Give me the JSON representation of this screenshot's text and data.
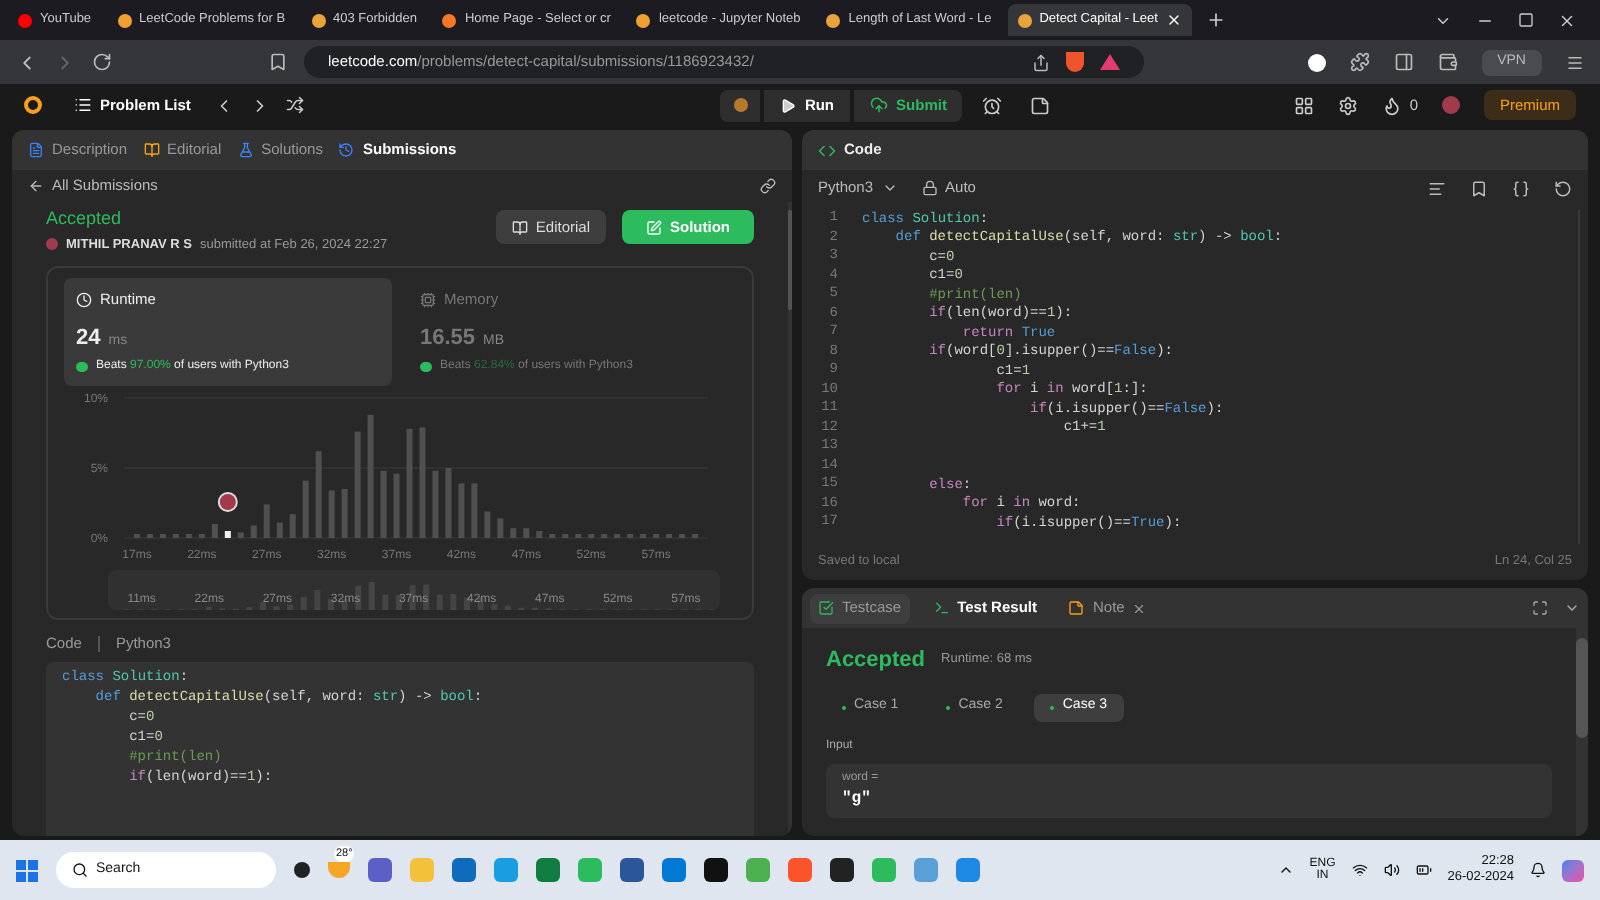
{
  "browser": {
    "tabs": [
      {
        "title": "YouTube",
        "selected": false,
        "color": "#ff0000"
      },
      {
        "title": "LeetCode Problems for B",
        "selected": false,
        "color": "#f0a030"
      },
      {
        "title": "403 Forbidden",
        "selected": false,
        "color": "#e8a33a"
      },
      {
        "title": "Home Page - Select or cr",
        "selected": false,
        "color": "#f37726"
      },
      {
        "title": "leetcode - Jupyter Noteb",
        "selected": false,
        "color": "#f0a030"
      },
      {
        "title": "Length of Last Word - Le",
        "selected": false,
        "color": "#e8a33a"
      },
      {
        "title": "Detect Capital - Leet",
        "selected": true,
        "color": "#e8a33a"
      }
    ],
    "url_host": "leetcode.com",
    "url_path": "/problems/detect-capital/submissions/1186923432/",
    "vpn": "VPN"
  },
  "nav": {
    "problem_list": "Problem List",
    "run": "Run",
    "submit": "Submit",
    "streak": "0",
    "premium": "Premium"
  },
  "left": {
    "tabs": [
      {
        "label": "Description",
        "selected": false
      },
      {
        "label": "Editorial",
        "selected": false
      },
      {
        "label": "Solutions",
        "selected": false
      },
      {
        "label": "Submissions",
        "selected": true
      }
    ],
    "back": "All Submissions",
    "status": "Accepted",
    "author": "MITHIL PRANAV R S",
    "submitted": "submitted at Feb 26, 2024 22:27",
    "buttons": [
      "Editorial",
      "Solution"
    ],
    "stats": [
      {
        "label": "Runtime",
        "value": "24",
        "unit": "ms",
        "prefix": "Beats",
        "percent": "97.00%",
        "suffix": "of users with Python3",
        "selected": true
      },
      {
        "label": "Memory",
        "value": "16.55",
        "unit": "MB",
        "prefix": "Beats",
        "percent": "62.84%",
        "suffix": "of users with Python3",
        "selected": false
      }
    ],
    "chart_data": {
      "type": "bar",
      "x": [
        17,
        18,
        19,
        20,
        21,
        22,
        23,
        24,
        25,
        26,
        27,
        28,
        29,
        30,
        31,
        32,
        33,
        34,
        35,
        36,
        37,
        38,
        39,
        40,
        41,
        42,
        43,
        44,
        45,
        46,
        47,
        48,
        49,
        50,
        51,
        52,
        53,
        54,
        55,
        56,
        57,
        58,
        59,
        60
      ],
      "values": [
        0.2,
        0.2,
        0.2,
        0.2,
        0.2,
        0.2,
        1.0,
        0.5,
        0.4,
        0.9,
        2.4,
        1.1,
        1.7,
        4.1,
        6.2,
        3.4,
        3.5,
        7.6,
        8.8,
        4.8,
        4.6,
        7.8,
        7.9,
        4.8,
        5.0,
        3.9,
        3.9,
        1.9,
        1.4,
        0.7,
        0.7,
        0.5,
        0.2,
        0.2,
        0.2,
        0.2,
        0.2,
        0.2,
        0.2,
        0.2,
        0.2,
        0.2,
        0.2,
        0.2
      ],
      "xlim": [
        16,
        61
      ],
      "ylim": [
        0,
        10
      ],
      "yticks": [
        {
          "value": 0,
          "label": "0%"
        },
        {
          "value": 5,
          "label": "5%"
        },
        {
          "value": 10,
          "label": "10%"
        }
      ],
      "xticks": [
        {
          "value": 17,
          "label": "17ms"
        },
        {
          "value": 22,
          "label": "22ms"
        },
        {
          "value": 27,
          "label": "27ms"
        },
        {
          "value": 32,
          "label": "32ms"
        },
        {
          "value": 37,
          "label": "37ms"
        },
        {
          "value": 42,
          "label": "42ms"
        },
        {
          "value": 47,
          "label": "47ms"
        },
        {
          "value": 52,
          "label": "52ms"
        },
        {
          "value": 57,
          "label": "57ms"
        }
      ]
    },
    "overview_labels": [
      "11ms",
      "22ms",
      "27ms",
      "32ms",
      "37ms",
      "42ms",
      "47ms",
      "52ms",
      "57ms"
    ],
    "code_label": "Code",
    "code_lang": "Python3",
    "code": [
      [
        {
          "text": "class ",
          "kind": "kw"
        },
        {
          "text": "Solution",
          "kind": "cls"
        },
        {
          "text": ":",
          "kind": "p"
        }
      ],
      [
        {
          "text": "    def ",
          "kind": "kw"
        },
        {
          "text": "detectCapitalUse",
          "kind": "fn"
        },
        {
          "text": "(self, word: ",
          "kind": "p"
        },
        {
          "text": "str",
          "kind": "type"
        },
        {
          "text": ") -> ",
          "kind": "p"
        },
        {
          "text": "bool",
          "kind": "type"
        },
        {
          "text": ":",
          "kind": "p"
        }
      ],
      [
        {
          "text": "        c=",
          "kind": "p"
        },
        {
          "text": "0",
          "kind": "num"
        }
      ],
      [
        {
          "text": "        c1=",
          "kind": "p"
        },
        {
          "text": "0",
          "kind": "num"
        }
      ],
      [
        {
          "text": "        #print(len)",
          "kind": "comment"
        }
      ],
      [
        {
          "text": "        if",
          "kind": "ctrl"
        },
        {
          "text": "(len(word)==",
          "kind": "p"
        },
        {
          "text": "1",
          "kind": "num"
        },
        {
          "text": "):",
          "kind": "p"
        }
      ]
    ]
  },
  "editor": {
    "title": "Code",
    "language": "Python3",
    "mode": "Auto",
    "saved": "Saved to local",
    "cursor": "Ln 24, Col 25",
    "lines": [
      {
        "number": "1",
        "tokens": [
          {
            "text": "class ",
            "kind": "kw"
          },
          {
            "text": "Solution",
            "kind": "cls"
          },
          {
            "text": ":",
            "kind": "p"
          }
        ]
      },
      {
        "number": "2",
        "tokens": [
          {
            "text": "    def ",
            "kind": "kw"
          },
          {
            "text": "detectCapitalUse",
            "kind": "fn"
          },
          {
            "text": "(self, word: ",
            "kind": "p"
          },
          {
            "text": "str",
            "kind": "type"
          },
          {
            "text": ") -> ",
            "kind": "p"
          },
          {
            "text": "bool",
            "kind": "type"
          },
          {
            "text": ":",
            "kind": "p"
          }
        ]
      },
      {
        "number": "3",
        "tokens": [
          {
            "text": "        c=",
            "kind": "p"
          },
          {
            "text": "0",
            "kind": "num"
          }
        ]
      },
      {
        "number": "4",
        "tokens": [
          {
            "text": "        c1=",
            "kind": "p"
          },
          {
            "text": "0",
            "kind": "num"
          }
        ]
      },
      {
        "number": "5",
        "tokens": [
          {
            "text": "        #print(len)",
            "kind": "comment"
          }
        ]
      },
      {
        "number": "6",
        "tokens": [
          {
            "text": "        if",
            "kind": "ctrl"
          },
          {
            "text": "(len(word)==",
            "kind": "p"
          },
          {
            "text": "1",
            "kind": "num"
          },
          {
            "text": "):",
            "kind": "p"
          }
        ]
      },
      {
        "number": "7",
        "tokens": [
          {
            "text": "            return ",
            "kind": "ctrl"
          },
          {
            "text": "True",
            "kind": "kw"
          }
        ]
      },
      {
        "number": "8",
        "tokens": [
          {
            "text": "        if",
            "kind": "ctrl"
          },
          {
            "text": "(word[",
            "kind": "p"
          },
          {
            "text": "0",
            "kind": "num"
          },
          {
            "text": "].isupper()==",
            "kind": "p"
          },
          {
            "text": "False",
            "kind": "kw"
          },
          {
            "text": "):",
            "kind": "p"
          }
        ]
      },
      {
        "number": "9",
        "tokens": [
          {
            "text": "                c1=",
            "kind": "p"
          },
          {
            "text": "1",
            "kind": "num"
          }
        ]
      },
      {
        "number": "10",
        "tokens": [
          {
            "text": "                for ",
            "kind": "ctrl"
          },
          {
            "text": "i ",
            "kind": "p"
          },
          {
            "text": "in ",
            "kind": "ctrl"
          },
          {
            "text": "word[",
            "kind": "p"
          },
          {
            "text": "1",
            "kind": "num"
          },
          {
            "text": ":]:",
            "kind": "p"
          }
        ]
      },
      {
        "number": "11",
        "tokens": [
          {
            "text": "                    if",
            "kind": "ctrl"
          },
          {
            "text": "(i.isupper()==",
            "kind": "p"
          },
          {
            "text": "False",
            "kind": "kw"
          },
          {
            "text": "):",
            "kind": "p"
          }
        ]
      },
      {
        "number": "12",
        "tokens": [
          {
            "text": "                        c1+=",
            "kind": "p"
          },
          {
            "text": "1",
            "kind": "num"
          }
        ]
      },
      {
        "number": "13"
      },
      {
        "number": "14"
      },
      {
        "number": "15",
        "tokens": [
          {
            "text": "        else",
            "kind": "ctrl"
          },
          {
            "text": ":",
            "kind": "p"
          }
        ]
      },
      {
        "number": "16",
        "tokens": [
          {
            "text": "            for ",
            "kind": "ctrl"
          },
          {
            "text": "i ",
            "kind": "p"
          },
          {
            "text": "in ",
            "kind": "ctrl"
          },
          {
            "text": "word:",
            "kind": "p"
          }
        ]
      },
      {
        "number": "17",
        "tokens": [
          {
            "text": "                if",
            "kind": "ctrl"
          },
          {
            "text": "(i.isupper()==",
            "kind": "p"
          },
          {
            "text": "True",
            "kind": "kw"
          },
          {
            "text": "):",
            "kind": "p"
          }
        ]
      }
    ]
  },
  "console": {
    "tabs": [
      {
        "label": "Testcase",
        "selected": false
      },
      {
        "label": "Test Result",
        "selected": true
      },
      {
        "label": "Note",
        "selected": false
      }
    ],
    "status": "Accepted",
    "runtime": "Runtime: 68 ms",
    "cases": [
      {
        "label": "Case 1",
        "selected": false
      },
      {
        "label": "Case 2",
        "selected": false
      },
      {
        "label": "Case 3",
        "selected": true
      }
    ],
    "input_label": "Input",
    "var": "word =",
    "value": "\"g\""
  },
  "taskbar": {
    "search": "Search",
    "temperature": "28°",
    "lang": "ENG",
    "region": "IN",
    "time": "22:28",
    "date": "26-02-2024"
  }
}
